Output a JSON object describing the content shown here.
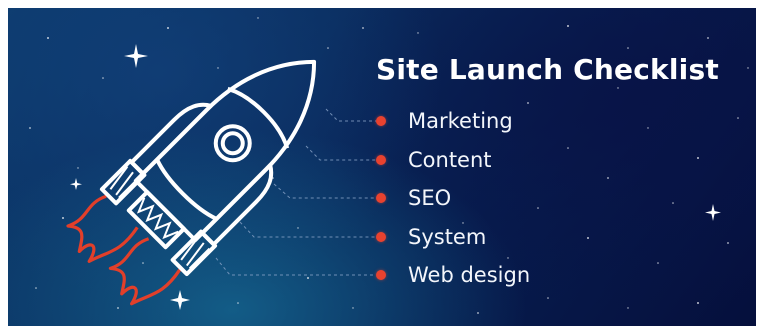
{
  "title": "Site Launch Checklist",
  "checklist": [
    {
      "label": "Marketing"
    },
    {
      "label": "Content"
    },
    {
      "label": "SEO"
    },
    {
      "label": "System"
    },
    {
      "label": "Web design"
    }
  ],
  "colors": {
    "bullet": "#e8422f",
    "flame": "#e23f2a",
    "rocket_outline": "#ffffff",
    "background_dark": "#050f3c",
    "background_teal": "#166e96"
  },
  "icons": [
    "rocket-icon",
    "star-icon"
  ]
}
